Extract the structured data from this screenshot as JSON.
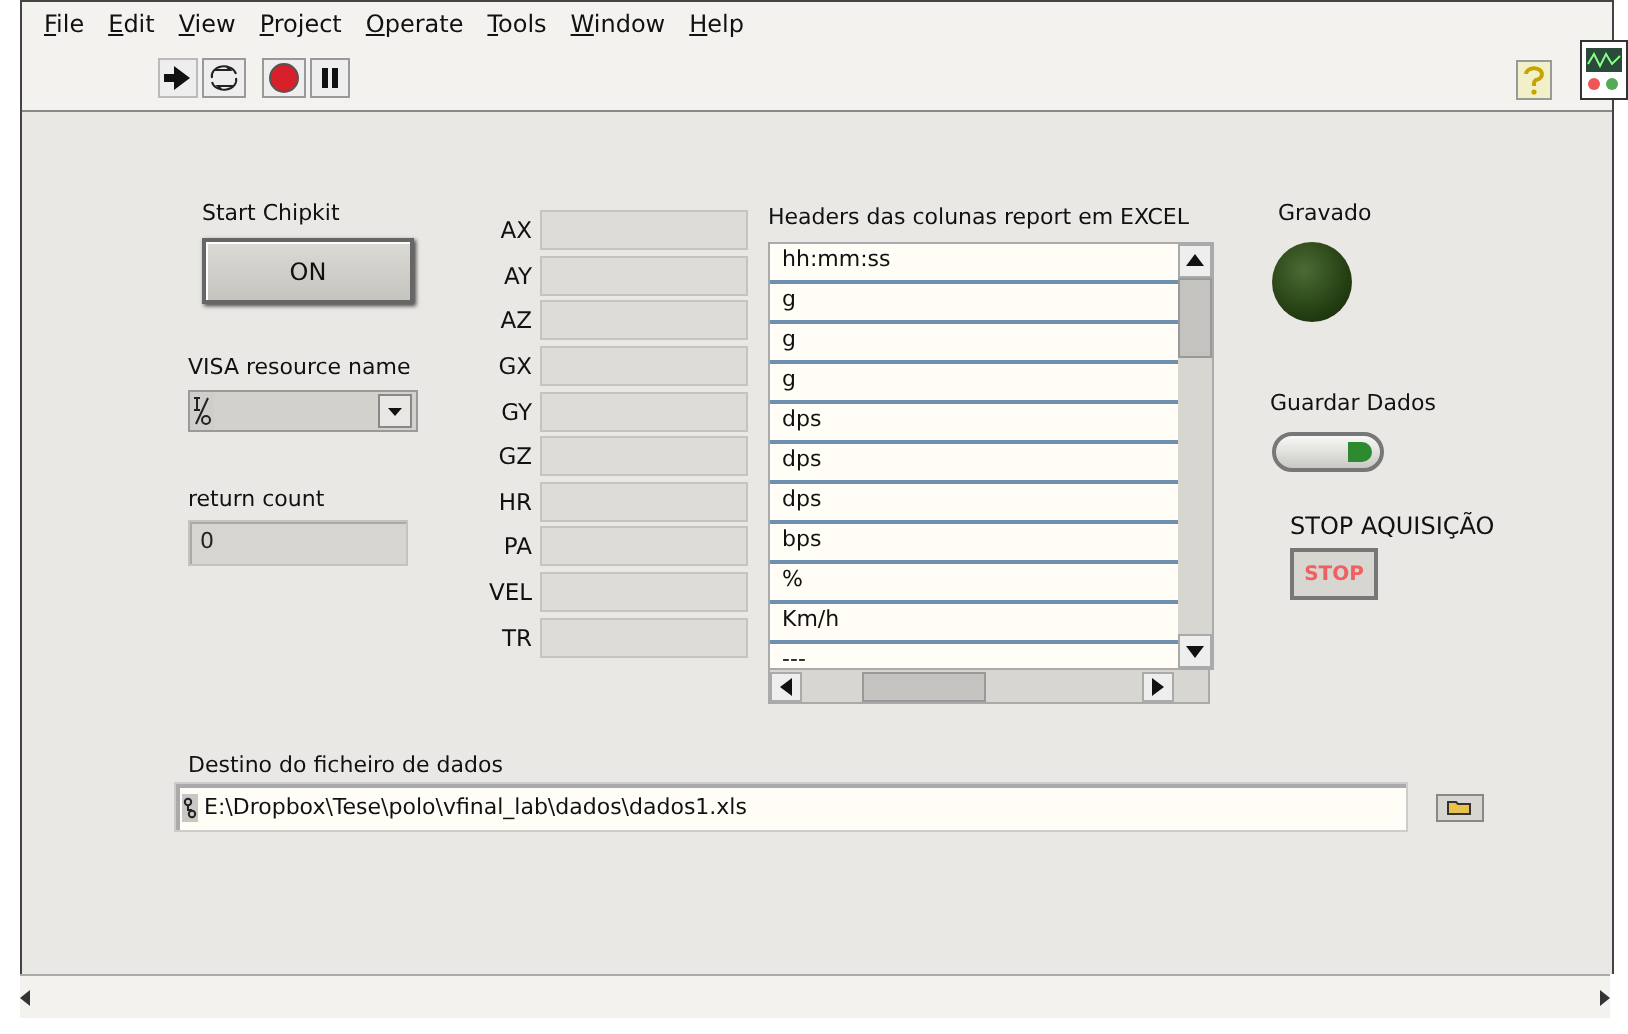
{
  "menu": [
    {
      "label": "File"
    },
    {
      "label": "Edit"
    },
    {
      "label": "View"
    },
    {
      "label": "Project"
    },
    {
      "label": "Operate"
    },
    {
      "label": "Tools"
    },
    {
      "label": "Window"
    },
    {
      "label": "Help"
    }
  ],
  "start_button": {
    "label": "Start Chipkit",
    "text": "ON",
    "pressed": false
  },
  "visa": {
    "label": "VISA resource name"
  },
  "return_count": {
    "label": "return count",
    "value": "0"
  },
  "indicators": [
    {
      "label": "AX"
    },
    {
      "label": "AY"
    },
    {
      "label": "AZ"
    },
    {
      "label": "GX"
    },
    {
      "label": "GY"
    },
    {
      "label": "GZ"
    },
    {
      "label": "HR"
    },
    {
      "label": "PA"
    },
    {
      "label": "VEL"
    },
    {
      "label": "TR"
    }
  ],
  "headers": {
    "label": "Headers das colunas report em EXCEL",
    "items": [
      "hh:mm:ss",
      "g",
      "g",
      "g",
      "dps",
      "dps",
      "dps",
      "bps",
      "%",
      "Km/h",
      "---"
    ]
  },
  "led": {
    "label": "Gravado",
    "on": false
  },
  "toggle": {
    "label": "Guardar Dados",
    "on": true
  },
  "stop": {
    "label": "STOP AQUISIÇÃO",
    "text": "STOP"
  },
  "path": {
    "label": "Destino do ficheiro de dados",
    "value": "E:\\Dropbox\\Tese\\polo\\vfinal_lab\\dados\\dados1.xls"
  }
}
